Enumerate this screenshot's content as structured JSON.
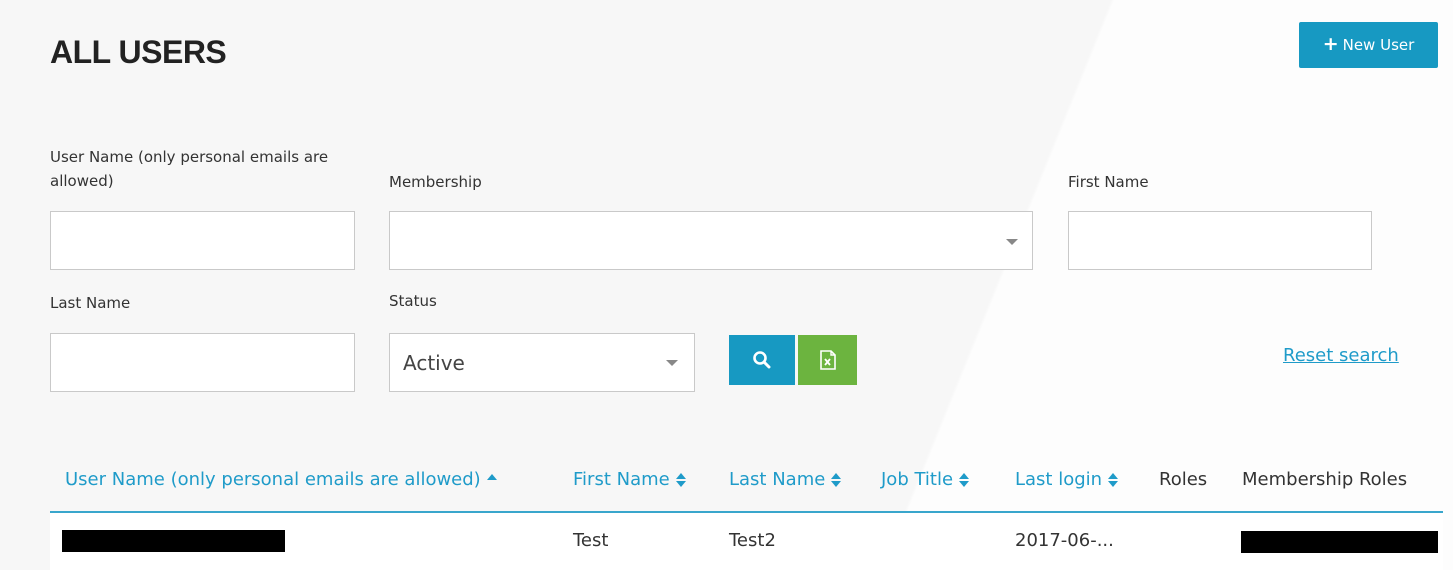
{
  "header": {
    "title": "ALL USERS",
    "new_user_label": "New User",
    "new_user_icon": "plus-icon"
  },
  "filters": {
    "username_label": "User Name (only personal emails are allowed)",
    "username_value": "",
    "membership_label": "Membership",
    "membership_value": "",
    "firstname_label": "First Name",
    "firstname_value": "",
    "lastname_label": "Last Name",
    "lastname_value": "",
    "status_label": "Status",
    "status_value": "Active",
    "search_icon": "search-icon",
    "export_icon": "excel-export-icon",
    "reset_label": "Reset search"
  },
  "table": {
    "columns": [
      {
        "label": "User Name (only personal emails are allowed)",
        "sortable": true,
        "sort": "asc"
      },
      {
        "label": "First Name",
        "sortable": true
      },
      {
        "label": "Last Name",
        "sortable": true
      },
      {
        "label": "Job Title",
        "sortable": true
      },
      {
        "label": "Last login",
        "sortable": true
      },
      {
        "label": "Roles",
        "sortable": false
      },
      {
        "label": "Membership Roles",
        "sortable": false
      }
    ],
    "rows": [
      {
        "username": "",
        "first_name": "Test",
        "last_name": "Test2",
        "job_title": "",
        "last_login": "2017-06-...",
        "roles": "",
        "membership_roles": ""
      }
    ]
  },
  "colors": {
    "accent": "#1799c2",
    "link": "#1f9bc9",
    "export": "#6cb43f"
  }
}
